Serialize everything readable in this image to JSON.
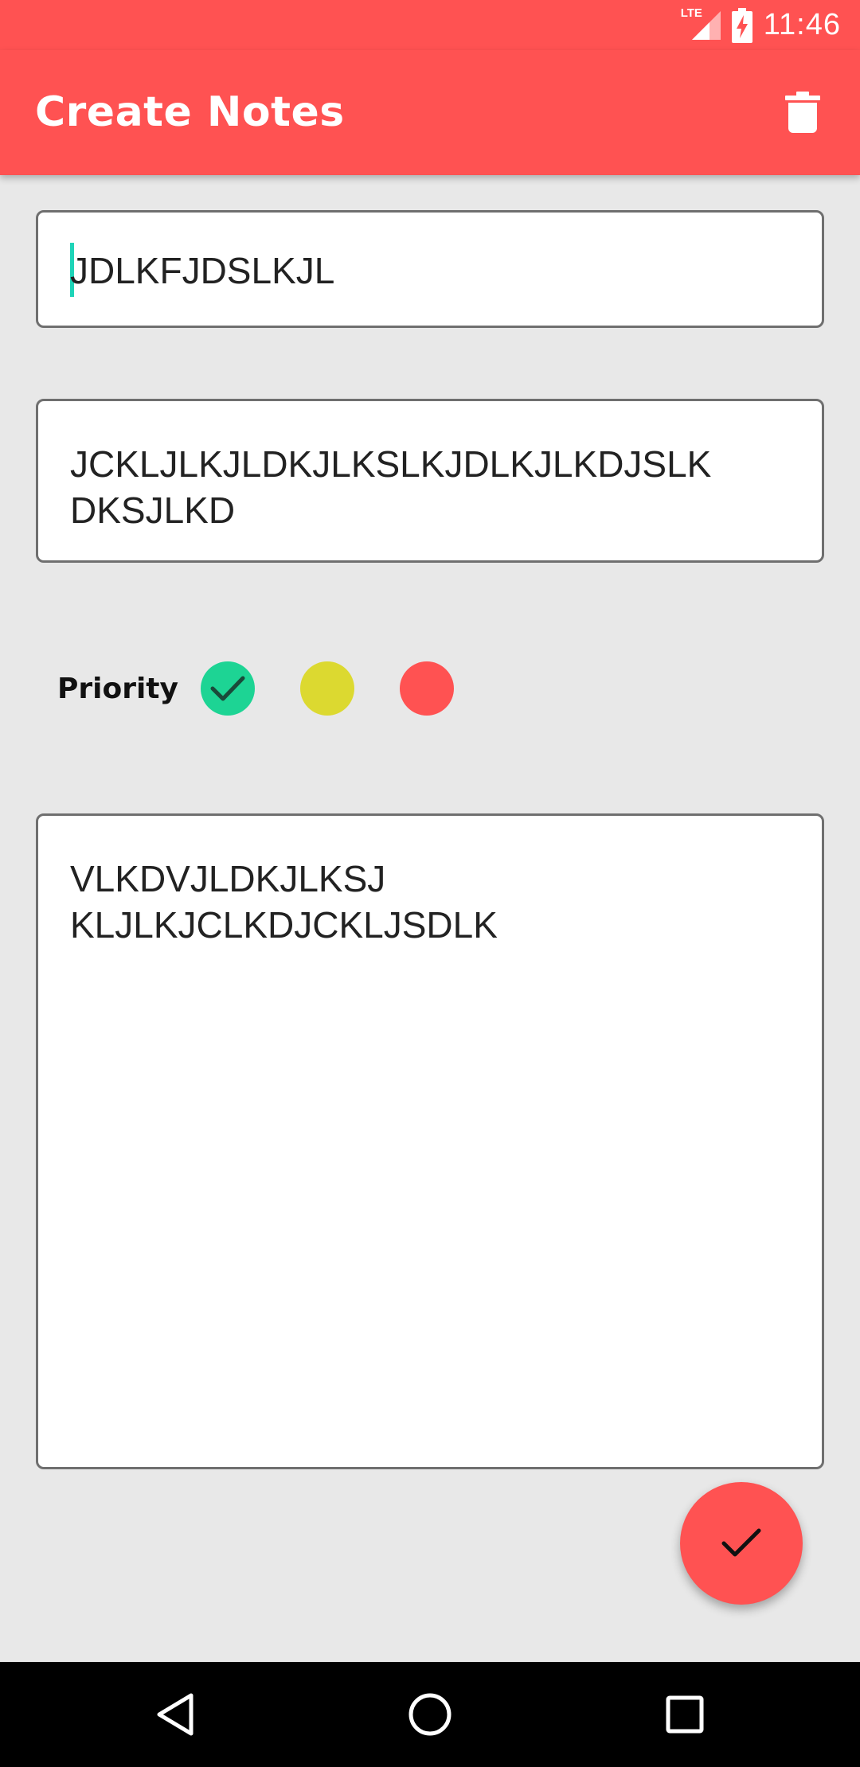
{
  "status_bar": {
    "network_label": "LTE",
    "time": "11:46"
  },
  "app_bar": {
    "title": "Create Notes",
    "delete_icon": "delete-icon"
  },
  "form": {
    "title_value": "JDLKFJDSLKJL",
    "subtitle_value": "JCKLJLKJLDKJLKSLKJDLKJLKDJSLK\nDKSJLKD",
    "note_value": "VLKDVJLDKJLKSJ\nKLJLKJCLKDJCKLJSDLK"
  },
  "priority": {
    "label": "Priority",
    "options": [
      {
        "color": "#1dd494",
        "selected": true
      },
      {
        "color": "#dcd930",
        "selected": false
      },
      {
        "color": "#ff5252",
        "selected": false
      }
    ]
  },
  "fab": {
    "icon": "check-icon"
  },
  "colors": {
    "accent": "#ff5252",
    "background": "#e8e8e8",
    "caret": "#1ed4b8"
  },
  "nav_bar": {
    "icons": [
      "back-icon",
      "home-icon",
      "recents-icon"
    ]
  }
}
